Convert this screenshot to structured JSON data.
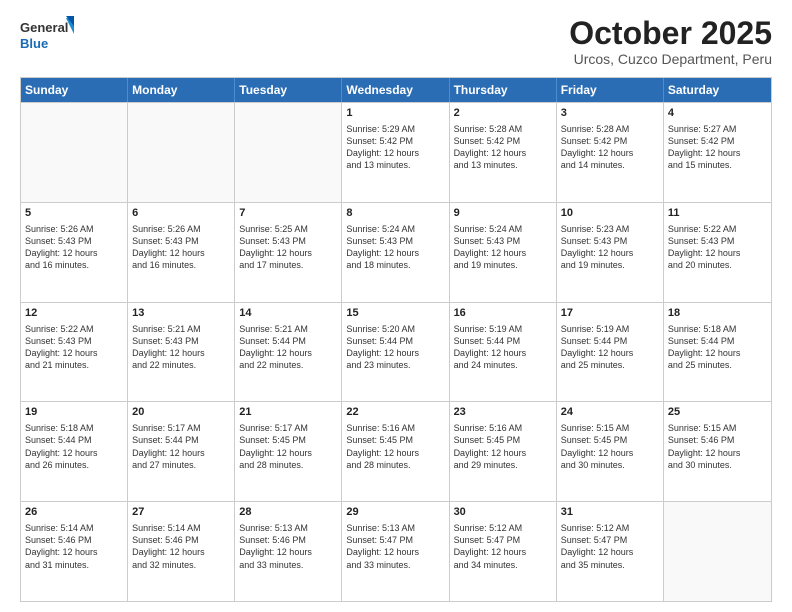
{
  "logo": {
    "general": "General",
    "blue": "Blue"
  },
  "title": "October 2025",
  "subtitle": "Urcos, Cuzco Department, Peru",
  "days": [
    "Sunday",
    "Monday",
    "Tuesday",
    "Wednesday",
    "Thursday",
    "Friday",
    "Saturday"
  ],
  "weeks": [
    [
      {
        "day": "",
        "info": ""
      },
      {
        "day": "",
        "info": ""
      },
      {
        "day": "",
        "info": ""
      },
      {
        "day": "1",
        "info": "Sunrise: 5:29 AM\nSunset: 5:42 PM\nDaylight: 12 hours\nand 13 minutes."
      },
      {
        "day": "2",
        "info": "Sunrise: 5:28 AM\nSunset: 5:42 PM\nDaylight: 12 hours\nand 13 minutes."
      },
      {
        "day": "3",
        "info": "Sunrise: 5:28 AM\nSunset: 5:42 PM\nDaylight: 12 hours\nand 14 minutes."
      },
      {
        "day": "4",
        "info": "Sunrise: 5:27 AM\nSunset: 5:42 PM\nDaylight: 12 hours\nand 15 minutes."
      }
    ],
    [
      {
        "day": "5",
        "info": "Sunrise: 5:26 AM\nSunset: 5:43 PM\nDaylight: 12 hours\nand 16 minutes."
      },
      {
        "day": "6",
        "info": "Sunrise: 5:26 AM\nSunset: 5:43 PM\nDaylight: 12 hours\nand 16 minutes."
      },
      {
        "day": "7",
        "info": "Sunrise: 5:25 AM\nSunset: 5:43 PM\nDaylight: 12 hours\nand 17 minutes."
      },
      {
        "day": "8",
        "info": "Sunrise: 5:24 AM\nSunset: 5:43 PM\nDaylight: 12 hours\nand 18 minutes."
      },
      {
        "day": "9",
        "info": "Sunrise: 5:24 AM\nSunset: 5:43 PM\nDaylight: 12 hours\nand 19 minutes."
      },
      {
        "day": "10",
        "info": "Sunrise: 5:23 AM\nSunset: 5:43 PM\nDaylight: 12 hours\nand 19 minutes."
      },
      {
        "day": "11",
        "info": "Sunrise: 5:22 AM\nSunset: 5:43 PM\nDaylight: 12 hours\nand 20 minutes."
      }
    ],
    [
      {
        "day": "12",
        "info": "Sunrise: 5:22 AM\nSunset: 5:43 PM\nDaylight: 12 hours\nand 21 minutes."
      },
      {
        "day": "13",
        "info": "Sunrise: 5:21 AM\nSunset: 5:43 PM\nDaylight: 12 hours\nand 22 minutes."
      },
      {
        "day": "14",
        "info": "Sunrise: 5:21 AM\nSunset: 5:44 PM\nDaylight: 12 hours\nand 22 minutes."
      },
      {
        "day": "15",
        "info": "Sunrise: 5:20 AM\nSunset: 5:44 PM\nDaylight: 12 hours\nand 23 minutes."
      },
      {
        "day": "16",
        "info": "Sunrise: 5:19 AM\nSunset: 5:44 PM\nDaylight: 12 hours\nand 24 minutes."
      },
      {
        "day": "17",
        "info": "Sunrise: 5:19 AM\nSunset: 5:44 PM\nDaylight: 12 hours\nand 25 minutes."
      },
      {
        "day": "18",
        "info": "Sunrise: 5:18 AM\nSunset: 5:44 PM\nDaylight: 12 hours\nand 25 minutes."
      }
    ],
    [
      {
        "day": "19",
        "info": "Sunrise: 5:18 AM\nSunset: 5:44 PM\nDaylight: 12 hours\nand 26 minutes."
      },
      {
        "day": "20",
        "info": "Sunrise: 5:17 AM\nSunset: 5:44 PM\nDaylight: 12 hours\nand 27 minutes."
      },
      {
        "day": "21",
        "info": "Sunrise: 5:17 AM\nSunset: 5:45 PM\nDaylight: 12 hours\nand 28 minutes."
      },
      {
        "day": "22",
        "info": "Sunrise: 5:16 AM\nSunset: 5:45 PM\nDaylight: 12 hours\nand 28 minutes."
      },
      {
        "day": "23",
        "info": "Sunrise: 5:16 AM\nSunset: 5:45 PM\nDaylight: 12 hours\nand 29 minutes."
      },
      {
        "day": "24",
        "info": "Sunrise: 5:15 AM\nSunset: 5:45 PM\nDaylight: 12 hours\nand 30 minutes."
      },
      {
        "day": "25",
        "info": "Sunrise: 5:15 AM\nSunset: 5:46 PM\nDaylight: 12 hours\nand 30 minutes."
      }
    ],
    [
      {
        "day": "26",
        "info": "Sunrise: 5:14 AM\nSunset: 5:46 PM\nDaylight: 12 hours\nand 31 minutes."
      },
      {
        "day": "27",
        "info": "Sunrise: 5:14 AM\nSunset: 5:46 PM\nDaylight: 12 hours\nand 32 minutes."
      },
      {
        "day": "28",
        "info": "Sunrise: 5:13 AM\nSunset: 5:46 PM\nDaylight: 12 hours\nand 33 minutes."
      },
      {
        "day": "29",
        "info": "Sunrise: 5:13 AM\nSunset: 5:47 PM\nDaylight: 12 hours\nand 33 minutes."
      },
      {
        "day": "30",
        "info": "Sunrise: 5:12 AM\nSunset: 5:47 PM\nDaylight: 12 hours\nand 34 minutes."
      },
      {
        "day": "31",
        "info": "Sunrise: 5:12 AM\nSunset: 5:47 PM\nDaylight: 12 hours\nand 35 minutes."
      },
      {
        "day": "",
        "info": ""
      }
    ]
  ]
}
